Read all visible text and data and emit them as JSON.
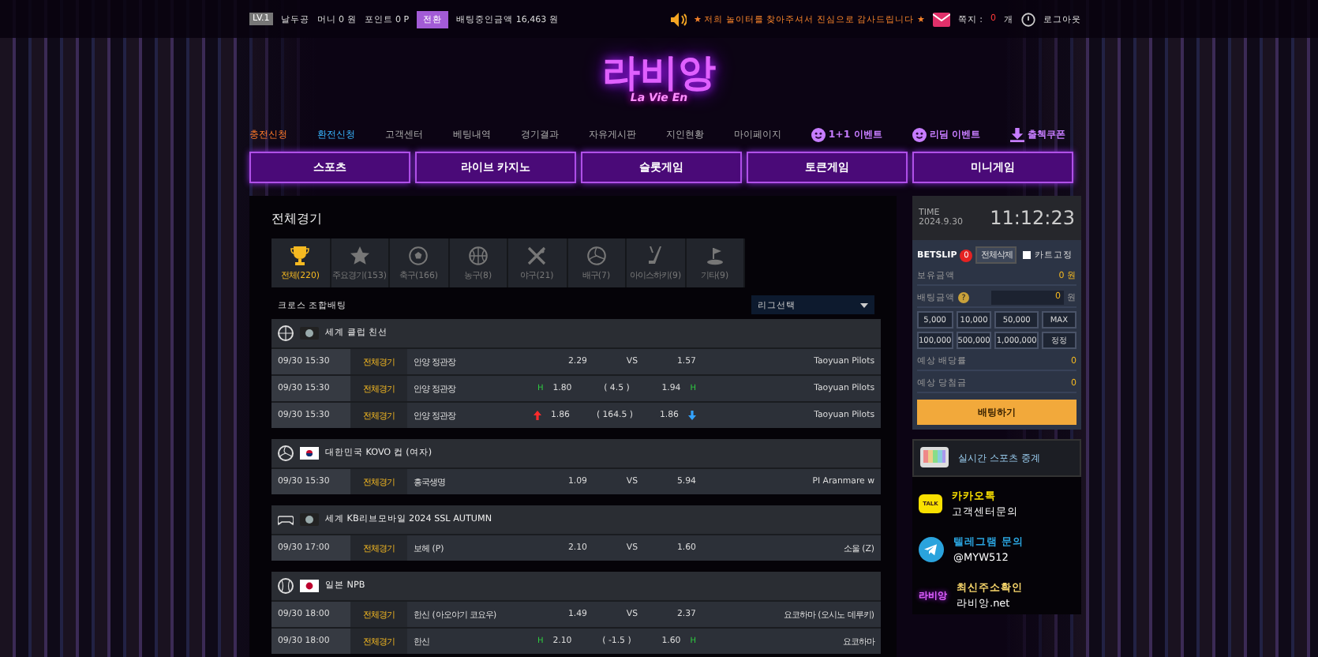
{
  "top_bar": {
    "level": "LV.1",
    "username": "날두공",
    "money": "머니 0 원",
    "point": "포인트 0 P",
    "convert_button": "전환",
    "betting_amount": "배팅중인금액 16,463 원",
    "notice": "★ 저희 놀이터를 찾아주셔서 진심으로 감사드립니다 ★",
    "messages_label": "쪽지 :",
    "messages_count": "0",
    "messages_unit": "개",
    "logout": "로그아웃"
  },
  "logo": {
    "title": "라비앙",
    "subtitle": "La Vie En"
  },
  "nav": [
    {
      "label": "충전신청",
      "kind": "charge"
    },
    {
      "label": "환전신청",
      "kind": "exchange"
    },
    {
      "label": "고객센터",
      "kind": "link"
    },
    {
      "label": "베팅내역",
      "kind": "link"
    },
    {
      "label": "경기결과",
      "kind": "link"
    },
    {
      "label": "자유게시판",
      "kind": "link"
    },
    {
      "label": "지인현황",
      "kind": "link"
    },
    {
      "label": "마이페이지",
      "kind": "link"
    },
    {
      "label": "1+1 이벤트",
      "kind": "event"
    },
    {
      "label": "리딤 이벤트",
      "kind": "event"
    },
    {
      "label": "출첵쿠폰",
      "kind": "download"
    }
  ],
  "categories": [
    "스포츠",
    "라이브 카지노",
    "슬롯게임",
    "토큰게임",
    "미니게임"
  ],
  "main": {
    "title": "전체경기",
    "sport_tabs": [
      {
        "kind": "all",
        "label": "전체(220)",
        "selected": true
      },
      {
        "kind": "featured",
        "label": "주요경기(153)",
        "selected": false
      },
      {
        "kind": "soccer",
        "label": "축구(166)",
        "selected": false
      },
      {
        "kind": "basketball",
        "label": "농구(8)",
        "selected": false
      },
      {
        "kind": "baseball",
        "label": "야구(21)",
        "selected": false
      },
      {
        "kind": "volleyball",
        "label": "배구(7)",
        "selected": false
      },
      {
        "kind": "hockey",
        "label": "아이스하키(9)",
        "selected": false
      },
      {
        "kind": "golf",
        "label": "기타(9)",
        "selected": false
      }
    ],
    "cross_label": "크로스 조합배팅",
    "league_select": "리그선택",
    "leagues": [
      {
        "kind": "basketball",
        "flag": {
          "kind": "world"
        },
        "name": "세계 클럽 친선",
        "games": [
          {
            "time": "09/30 15:30",
            "status": "전체경기",
            "home": "안양 정관장",
            "home_odds": "2.29",
            "center": "VS",
            "away_odds": "1.57",
            "away": "Taoyuan Pilots"
          },
          {
            "time": "09/30 15:30",
            "status": "전체경기",
            "home": "안양 정관장",
            "home_mark": {
              "kind": "text",
              "text": "H"
            },
            "home_odds": "1.80",
            "center": "( 4.5 )",
            "away_odds": "1.94",
            "away_mark": {
              "kind": "text",
              "text": "H"
            },
            "away": "Taoyuan Pilots"
          },
          {
            "time": "09/30 15:30",
            "status": "전체경기",
            "home": "안양 정관장",
            "home_mark": {
              "kind": "up"
            },
            "home_odds": "1.86",
            "center": "( 164.5 )",
            "away_odds": "1.86",
            "away_mark": {
              "kind": "down"
            },
            "away": "Taoyuan Pilots"
          }
        ]
      },
      {
        "kind": "volleyball",
        "flag": {
          "kind": "korea"
        },
        "name": "대한민국 KOVO 컵 (여자)",
        "games": [
          {
            "time": "09/30 15:30",
            "status": "전체경기",
            "home": "흥국생명",
            "home_odds": "1.09",
            "center": "VS",
            "away_odds": "5.94",
            "away": "PI Aranmare w"
          }
        ]
      },
      {
        "kind": "esports",
        "flag": {
          "kind": "world"
        },
        "name": "세계 KB리브모바일 2024 SSL AUTUMN",
        "games": [
          {
            "time": "09/30 17:00",
            "status": "전체경기",
            "home": "보헤 (P)",
            "home_odds": "2.10",
            "center": "VS",
            "away_odds": "1.60",
            "away": "소울 (Z)"
          }
        ]
      },
      {
        "kind": "baseball",
        "flag": {
          "kind": "japan"
        },
        "name": "일본 NPB",
        "games": [
          {
            "time": "09/30 18:00",
            "status": "전체경기",
            "home": "한신 (아오야기 코요우)",
            "home_odds": "1.49",
            "center": "VS",
            "away_odds": "2.37",
            "away": "요코하마 (오시노 데루키)"
          },
          {
            "time": "09/30 18:00",
            "status": "전체경기",
            "home": "한신",
            "home_mark": {
              "kind": "text",
              "text": "H"
            },
            "home_odds": "2.10",
            "center": "( -1.5 )",
            "away_odds": "1.60",
            "away_mark": {
              "kind": "text",
              "text": "H"
            },
            "away": "요코하마"
          }
        ]
      }
    ]
  },
  "side": {
    "time_label": "TIME",
    "date": "2024.9.30",
    "clock": "11:12:23",
    "betslip_title": "BETSLIP",
    "betslip_count": "0",
    "clear_button": "전체삭제",
    "cart_fix": {
      "label": "카트고정",
      "checked": false
    },
    "balance_label": "보유금액",
    "balance_value": "0 원",
    "bet_label": "배팅금액",
    "help": "?",
    "bet_value": "0",
    "bet_unit": "원",
    "chips": [
      "5,000",
      "10,000",
      "50,000",
      "MAX",
      "100,000",
      "500,000",
      "1,000,000",
      "정정"
    ],
    "odds_label": "예상 배당률",
    "odds_value": "0",
    "win_label": "예상 당첨금",
    "win_value": "0",
    "bet_button": "배팅하기",
    "live_banner": "실시간 스포츠 중계",
    "contacts": [
      {
        "kind": "kakao",
        "title": "카카오톡",
        "text": "고객센터문의",
        "icon_text": "TALK"
      },
      {
        "kind": "telegram",
        "title": "텔레그램 문의",
        "text": "@MYW512"
      },
      {
        "kind": "address",
        "title": "최신주소확인",
        "text": "라비앙.net",
        "icon_text": "라비앙"
      }
    ]
  }
}
